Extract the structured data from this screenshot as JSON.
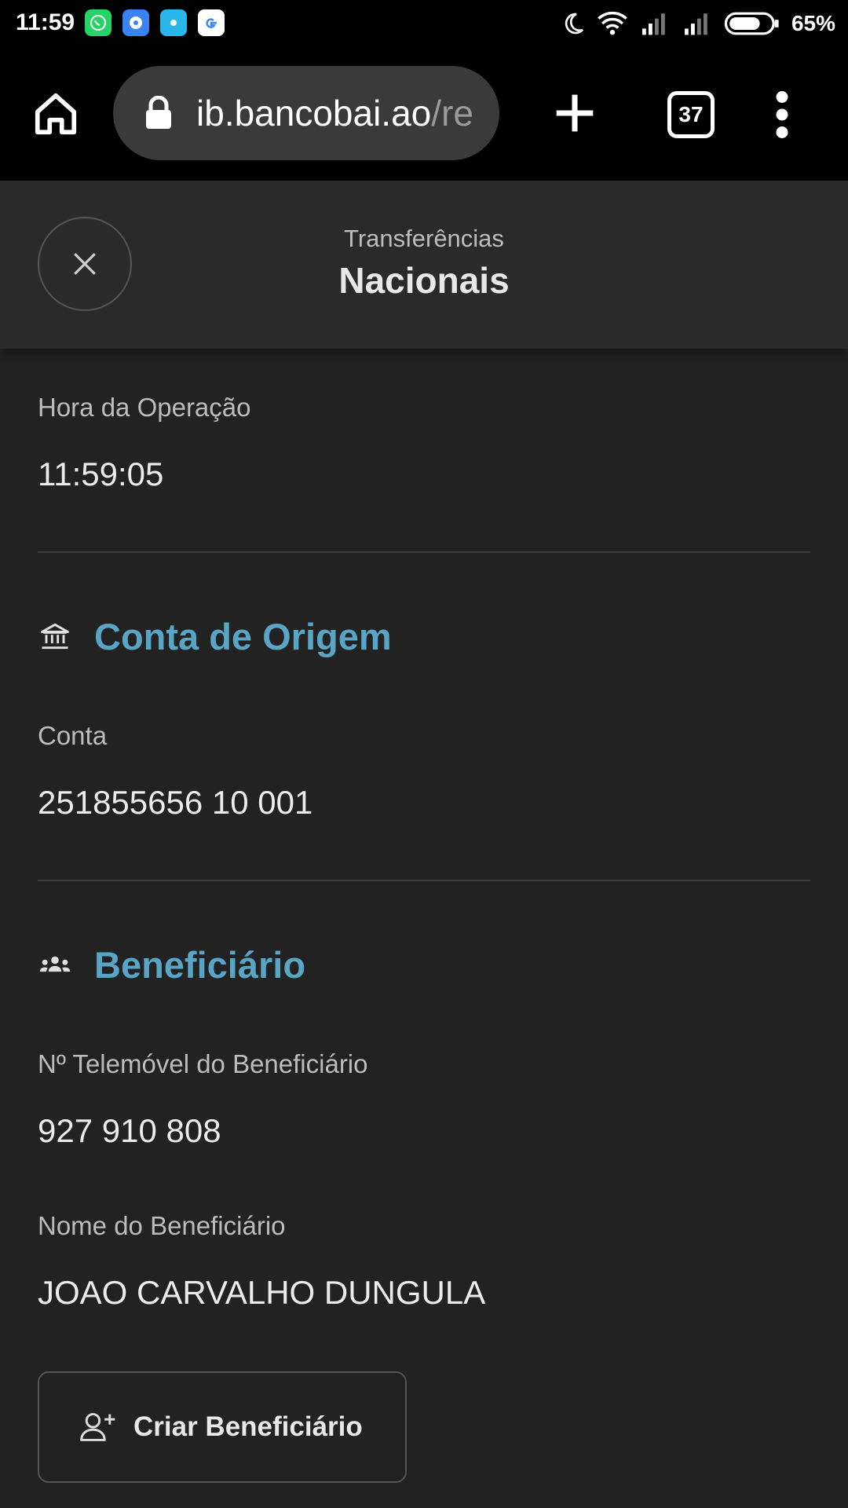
{
  "status_bar": {
    "time": "11:59",
    "battery": "65%"
  },
  "browser": {
    "url_host": "ib.bancobai.ao",
    "url_path": "/re",
    "tab_count": "37"
  },
  "header": {
    "subtitle": "Transferências",
    "title": "Nacionais"
  },
  "operation_time": {
    "label": "Hora da Operação",
    "value": "11:59:05"
  },
  "origin_account": {
    "section_title": "Conta de Origem",
    "account_label": "Conta",
    "account_value": "251855656 10 001"
  },
  "beneficiary": {
    "section_title": "Beneficiário",
    "phone_label": "Nº Telemóvel do Beneficiário",
    "phone_value": "927 910 808",
    "name_label": "Nome do Beneficiário",
    "name_value": "JOAO CARVALHO DUNGULA"
  },
  "create_beneficiary_button": "Criar Beneficiário",
  "colors": {
    "accent": "#58a5c6",
    "background": "#222222",
    "header_background": "#2a2a2a"
  },
  "icons": {
    "home": "home-icon",
    "lock": "lock-icon",
    "new_tab": "plus-icon",
    "menu": "more-vert-icon",
    "close": "close-icon",
    "bank": "bank-icon",
    "group": "group-icon",
    "add_person": "add-person-icon"
  }
}
